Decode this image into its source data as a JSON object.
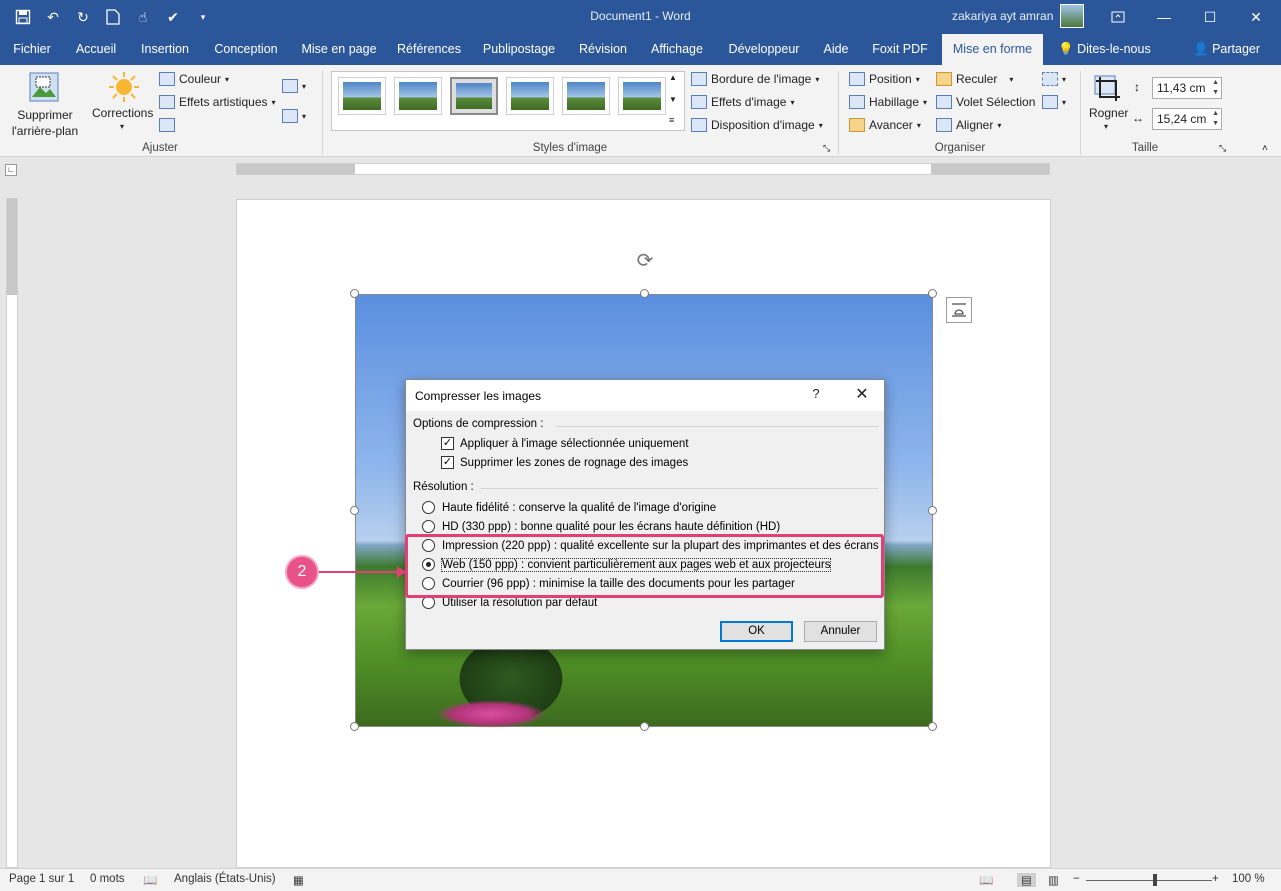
{
  "app": {
    "title": "Document1  -  Word",
    "user": "zakariya ayt amran"
  },
  "qat": {
    "save_icon": "save-icon",
    "undo_icon": "undo-icon",
    "redo_icon": "redo-icon",
    "new_icon": "new-document-icon",
    "touch_icon": "touch-mode-icon",
    "more_icon": "customize-qat-icon"
  },
  "window_controls": {
    "ribbon_options": "ribbon-display-options-icon",
    "minimize": "minimize-icon",
    "maximize": "maximize-icon",
    "close": "close-icon"
  },
  "tabs": [
    {
      "label": "Fichier"
    },
    {
      "label": "Accueil"
    },
    {
      "label": "Insertion"
    },
    {
      "label": "Conception"
    },
    {
      "label": "Mise en page"
    },
    {
      "label": "Références"
    },
    {
      "label": "Publipostage"
    },
    {
      "label": "Révision"
    },
    {
      "label": "Affichage"
    },
    {
      "label": "Développeur"
    },
    {
      "label": "Aide"
    },
    {
      "label": "Foxit PDF"
    },
    {
      "label": "Mise en forme"
    }
  ],
  "tell_me": "Dites-le-nous",
  "share": "Partager",
  "ribbon": {
    "ajuster": {
      "label": "Ajuster",
      "remove_bg": "Supprimer l'arrière-plan",
      "corrections": "Corrections",
      "color": "Couleur",
      "artistic": "Effets artistiques"
    },
    "styles": {
      "label": "Styles d'image",
      "border": "Bordure de l'image",
      "effects": "Effets d'image",
      "layout": "Disposition d'image"
    },
    "organiser": {
      "label": "Organiser",
      "position": "Position",
      "wrap": "Habillage",
      "forward": "Avancer",
      "backward": "Reculer",
      "selection_pane": "Volet Sélection",
      "align": "Aligner"
    },
    "taille": {
      "label": "Taille",
      "crop": "Rogner",
      "height": "11,43 cm",
      "width": "15,24 cm"
    }
  },
  "dialog": {
    "title": "Compresser les images",
    "help": "?",
    "close": "✕",
    "compression_section": "Options de compression :",
    "checkboxes": [
      {
        "label": "Appliquer à l'image sélectionnée uniquement",
        "checked": true
      },
      {
        "label": "Supprimer les zones de rognage des images",
        "checked": true
      }
    ],
    "resolution_section": "Résolution :",
    "radios": [
      {
        "label": "Haute fidélité : conserve la qualité de l'image d'origine",
        "selected": false
      },
      {
        "label": "HD (330 ppp) : bonne qualité pour les écrans haute définition (HD)",
        "selected": false
      },
      {
        "label": "Impression (220 ppp) : qualité excellente sur la plupart des imprimantes et des écrans",
        "selected": false
      },
      {
        "label": "Web (150 ppp) : convient particulièrement aux pages web et aux projecteurs",
        "selected": true
      },
      {
        "label": "Courrier (96 ppp) : minimise la taille des documents pour les partager",
        "selected": false
      },
      {
        "label": "Utiliser la résolution par défaut",
        "selected": false
      }
    ],
    "ok": "OK",
    "cancel": "Annuler"
  },
  "annotation": {
    "step": "2",
    "color": "#e33f76"
  },
  "statusbar": {
    "page": "Page 1 sur 1",
    "words": "0 mots",
    "language": "Anglais (États-Unis)",
    "zoom": "100 %"
  },
  "colors": {
    "accent": "#2b579a",
    "highlight": "#e33f76"
  }
}
